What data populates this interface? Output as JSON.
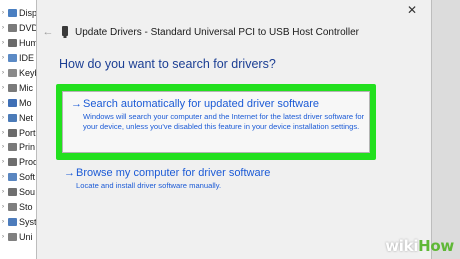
{
  "device_manager": {
    "items": [
      {
        "label": "Disp",
        "icon": "display-adapter-icon",
        "color": "#4a7fc1"
      },
      {
        "label": "DVD",
        "icon": "dvd-drive-icon",
        "color": "#7a7a7a"
      },
      {
        "label": "Hum",
        "icon": "hid-icon",
        "color": "#6a6a6a"
      },
      {
        "label": "IDE",
        "icon": "ide-controller-icon",
        "color": "#5b8ac5"
      },
      {
        "label": "Keyb",
        "icon": "keyboard-icon",
        "color": "#8a8a8a"
      },
      {
        "label": "Mic",
        "icon": "mice-icon",
        "color": "#7a7a7a"
      },
      {
        "label": "Mo",
        "icon": "monitor-icon",
        "color": "#3f6fb5"
      },
      {
        "label": "Net",
        "icon": "network-adapter-icon",
        "color": "#4b7bb8"
      },
      {
        "label": "Port",
        "icon": "port-icon",
        "color": "#6b6b6b"
      },
      {
        "label": "Prin",
        "icon": "printer-icon",
        "color": "#7a7a7a"
      },
      {
        "label": "Prod",
        "icon": "processor-icon",
        "color": "#6e6e6e"
      },
      {
        "label": "Soft",
        "icon": "software-device-icon",
        "color": "#5a86c0"
      },
      {
        "label": "Sou",
        "icon": "sound-icon",
        "color": "#6f6f6f"
      },
      {
        "label": "Sto",
        "icon": "storage-icon",
        "color": "#7f7f7f"
      },
      {
        "label": "Syst",
        "icon": "system-device-icon",
        "color": "#4d7cbc"
      },
      {
        "label": "Uni",
        "icon": "usb-controller-icon",
        "color": "#808080"
      }
    ]
  },
  "dialog": {
    "close_glyph": "✕",
    "back_glyph": "←",
    "title": "Update Drivers - Standard Universal PCI to USB Host Controller",
    "heading": "How do you want to search for drivers?",
    "option1": {
      "arrow": "→",
      "title": "Search automatically for updated driver software",
      "description": "Windows will search your computer and the Internet for the latest driver software for your device, unless you've disabled this feature in your device installation settings."
    },
    "option2": {
      "arrow": "→",
      "title": "Browse my computer for driver software",
      "description": "Locate and install driver software manually."
    }
  },
  "watermark": {
    "part1": "wiki",
    "part2": "How"
  },
  "colors": {
    "highlight": "#22e01e",
    "link": "#1c5bd6",
    "heading": "#1c3f94"
  }
}
